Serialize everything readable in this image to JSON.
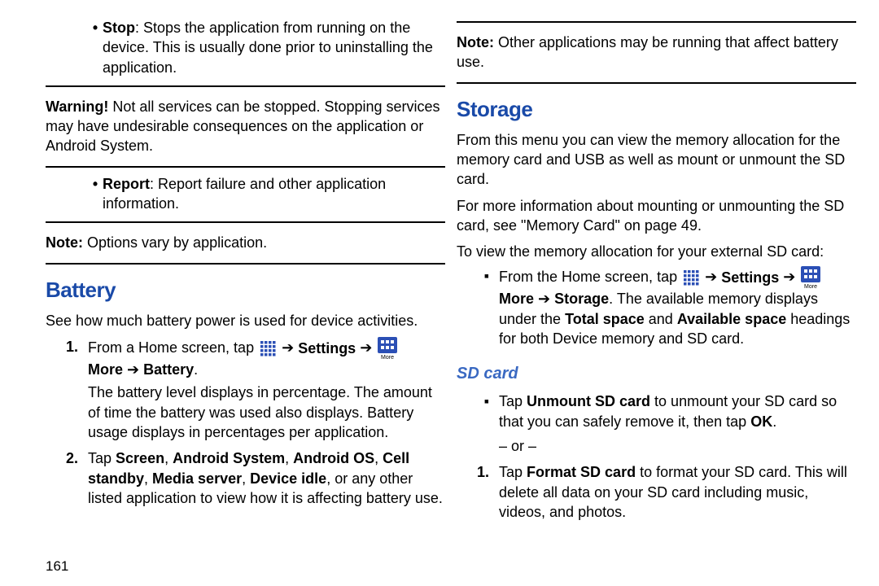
{
  "left": {
    "stop_label": "Stop",
    "stop_text": ": Stops the application from running on the device. This is usually done prior to uninstalling the application.",
    "warning_label": "Warning!",
    "warning_text": " Not all services can be stopped. Stopping services may have undesirable consequences on the application or Android System.",
    "report_label": "Report",
    "report_text": ": Report failure and other application information.",
    "note_label": "Note:",
    "note_text": " Options vary by application.",
    "battery_heading": "Battery",
    "battery_intro": "See how much battery power is used for device activities.",
    "step1_num": "1.",
    "step1_lead": "From a Home screen, tap ",
    "settings_word": "Settings",
    "arrow": " ➔ ",
    "more_word": "More",
    "battery_word": "Battery",
    "period": ".",
    "step1_tail": "The battery level displays in percentage. The amount of time the battery was used also displays. Battery usage displays in percentages per application.",
    "step2_num": "2.",
    "step2_a": "Tap ",
    "screen": "Screen",
    "androidsys": "Android System",
    "androidos": "Android OS",
    "cellstandby": "Cell standby",
    "mediaserver": "Media server",
    "deviceidle": "Device idle",
    "step2_tail": ", or any other listed application to view how it is affecting battery use.",
    "page_number": "161",
    "comma": ", "
  },
  "right": {
    "note_label": "Note:",
    "note_text": " Other applications may be running that affect battery use.",
    "storage_heading": "Storage",
    "storage_p1": "From this menu you can view the memory allocation for the memory card and USB as well as mount or unmount the SD card.",
    "storage_p2a": "For more information about mounting or unmounting the SD card, see ",
    "memory_card_quote": "\"Memory Card\"",
    "storage_p2b": " on page 49.",
    "storage_p3": "To view the memory allocation for your external SD card:",
    "bullet_lead": "From the Home screen, tap ",
    "settings_word": "Settings",
    "arrow": " ➔ ",
    "more_word": "More",
    "storage_word": "Storage",
    "bullet_mid": ". The available memory displays under the ",
    "totalspace": "Total space",
    "and": " and ",
    "availspace": "Available space",
    "bullet_tail": " headings for both Device memory and SD card.",
    "sdcard_heading": "SD card",
    "sd_p1a": "Tap ",
    "unmount": "Unmount SD card",
    "sd_p1b": " to unmount your SD card so that you can safely remove it, then tap ",
    "ok": "OK",
    "sd_p1c": ".",
    "or_line": "– or –",
    "sd_step_num": "1.",
    "sd_step_a": "Tap ",
    "format": "Format SD card",
    "sd_step_b": " to format your SD card. This will delete all data on your SD card including music, videos, and photos."
  }
}
